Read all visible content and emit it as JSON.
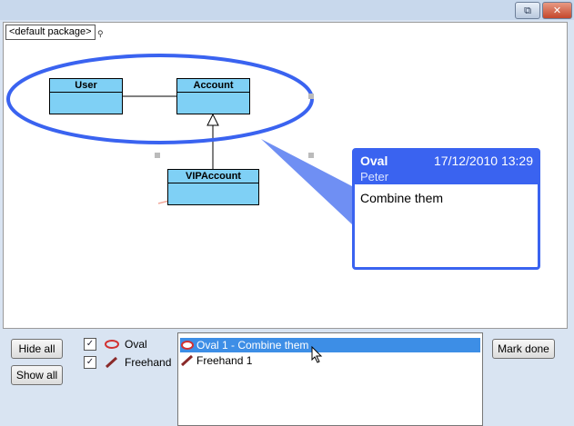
{
  "window": {
    "restore_icon": "restore-icon",
    "close_icon": "close-icon"
  },
  "diagram": {
    "package_tab": "<default package>",
    "classes": [
      {
        "name": "User"
      },
      {
        "name": "Account"
      },
      {
        "name": "VIPAccount"
      }
    ]
  },
  "comment": {
    "type": "Oval",
    "date": "17/12/2010 13:29",
    "author": "Peter",
    "text": "Combine them",
    "accent_color": "#3a63f0"
  },
  "panel": {
    "hide_all": "Hide all",
    "show_all": "Show all",
    "mark_done": "Mark done",
    "filters": [
      {
        "label": "Oval",
        "checked": true,
        "icon": "oval-icon"
      },
      {
        "label": "Freehand",
        "checked": true,
        "icon": "freehand-icon"
      }
    ],
    "items": [
      {
        "label": "Oval 1 - Combine them",
        "selected": true,
        "icon": "oval-icon"
      },
      {
        "label": "Freehand 1",
        "selected": false,
        "icon": "freehand-icon"
      }
    ]
  }
}
